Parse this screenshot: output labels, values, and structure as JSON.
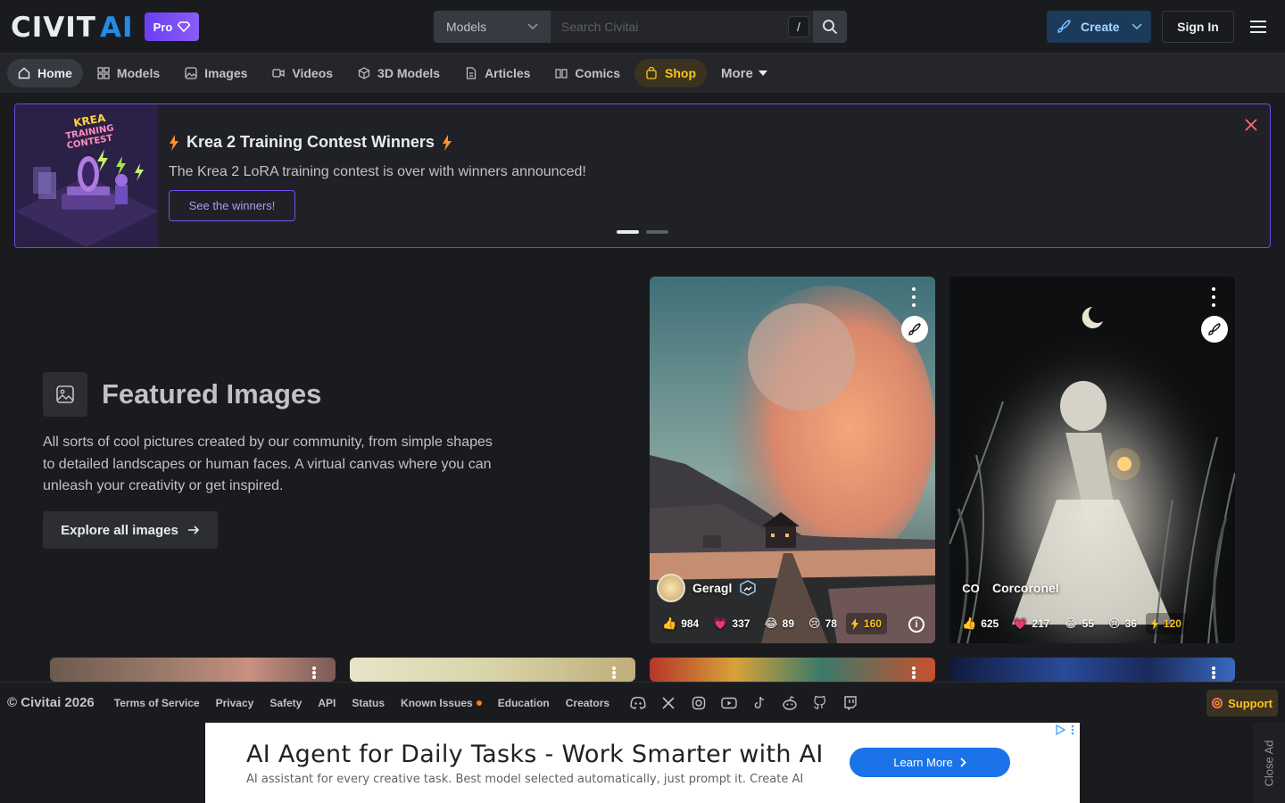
{
  "header": {
    "logo": "CIVITAI",
    "pro_label": "Pro",
    "search_type": "Models",
    "search_placeholder": "Search Civitai",
    "search_shortcut": "/",
    "create_label": "Create",
    "signin_label": "Sign In"
  },
  "nav": [
    {
      "label": "Home",
      "icon": "home-icon"
    },
    {
      "label": "Models",
      "icon": "grid-icon"
    },
    {
      "label": "Images",
      "icon": "image-icon"
    },
    {
      "label": "Videos",
      "icon": "video-icon"
    },
    {
      "label": "3D Models",
      "icon": "cube-icon"
    },
    {
      "label": "Articles",
      "icon": "article-icon"
    },
    {
      "label": "Comics",
      "icon": "book-icon"
    },
    {
      "label": "Shop",
      "icon": "shopping-bag-icon"
    },
    {
      "label": "More",
      "icon": "caret-down-icon"
    }
  ],
  "banner": {
    "title": "Krea 2 Training Contest Winners",
    "description": "The Krea 2 LoRA training contest is over with winners announced!",
    "button": "See the winners!",
    "image_text": "KREA TRAINING CONTEST"
  },
  "featured": {
    "title": "Featured Images",
    "description": "All sorts of cool pictures created by our community, from simple shapes to detailed landscapes or human faces. A virtual canvas where you can unleash your creativity or get inspired.",
    "button": "Explore all images"
  },
  "cards": [
    {
      "user": "Geragl",
      "reactions": {
        "like": "984",
        "heart": "337",
        "laugh": "89",
        "cry": "78",
        "buzz": "160"
      }
    },
    {
      "user": "Corcoronel",
      "initials": "CO",
      "reactions": {
        "like": "625",
        "heart": "217",
        "laugh": "55",
        "cry": "36",
        "buzz": "120"
      }
    }
  ],
  "footer": {
    "copyright": "© Civitai 2026",
    "links": [
      "Terms of Service",
      "Privacy",
      "Safety",
      "API",
      "Status",
      "Known Issues",
      "Education",
      "Creators"
    ],
    "support": "Support"
  },
  "ad": {
    "title": "AI Agent for Daily Tasks - Work Smarter with AI",
    "subtitle": "AI assistant for every creative task. Best model selected automatically, just prompt it. Create AI",
    "button": "Learn More",
    "close": "Close Ad"
  },
  "colors": {
    "accent_purple": "#7048e8",
    "accent_blue": "#228be6",
    "shop_yellow": "#fcc419",
    "background": "#1a1b1e"
  }
}
